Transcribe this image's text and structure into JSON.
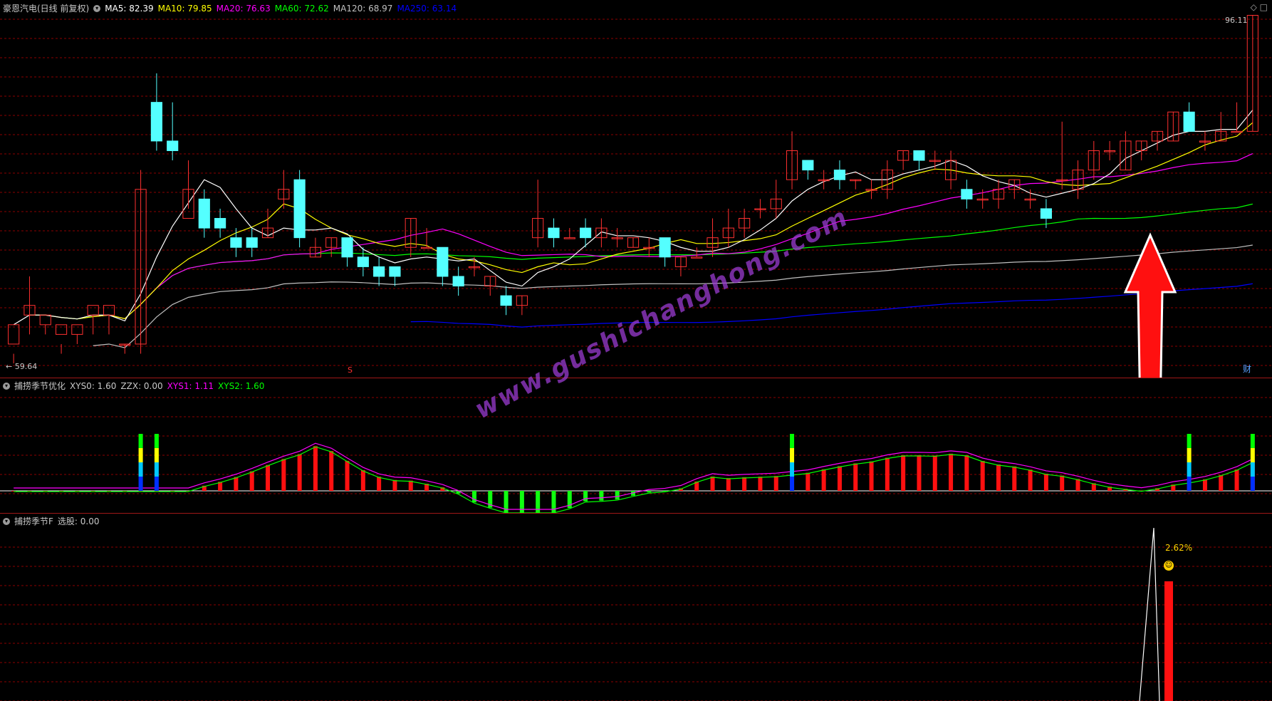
{
  "main_panel": {
    "title": "豪恩汽电(日线 前复权)",
    "ma_labels": [
      {
        "text": "MA5: 82.39",
        "color": "#ffffff"
      },
      {
        "text": "MA10: 79.85",
        "color": "#ffff00"
      },
      {
        "text": "MA20: 76.63",
        "color": "#ff00ff"
      },
      {
        "text": "MA60: 72.62",
        "color": "#00ff00"
      },
      {
        "text": "MA120: 68.97",
        "color": "#c0c0c0"
      },
      {
        "text": "MA250: 63.14",
        "color": "#0000ff"
      }
    ],
    "max_label": "96.11",
    "min_label": "59.64",
    "s_marker": "S",
    "cai_marker": "财",
    "icons": [
      "diamond-icon",
      "window-icon"
    ]
  },
  "panel2": {
    "title": "捕捞季节优化",
    "labels": [
      {
        "text": "XYS0: 1.60",
        "color": "#c8c8c8"
      },
      {
        "text": "ZZX: 0.00",
        "color": "#c8c8c8"
      },
      {
        "text": "XYS1: 1.11",
        "color": "#ff00ff"
      },
      {
        "text": "XYS2: 1.60",
        "color": "#00ff00"
      }
    ]
  },
  "panel3": {
    "title": "捕捞季节F",
    "labels": [
      {
        "text": "选股: 0.00",
        "color": "#c8c8c8"
      }
    ],
    "percent_label": "2.62%",
    "smile_icon": "smile-icon"
  },
  "watermark": "www.gushichanghong.com",
  "colors": {
    "up": "#ff3030",
    "down": "#54ffff",
    "grid": "#8b0000",
    "ma5": "#ffffff",
    "ma10": "#ffff00",
    "ma20": "#ff00ff",
    "ma60": "#00ff00",
    "ma120": "#c0c0c0",
    "ma250": "#0000ff"
  },
  "chart_data": {
    "type": "candlestick",
    "y_range": [
      59.64,
      96.11
    ],
    "candles": [
      [
        62,
        64,
        61,
        60
      ],
      [
        65,
        66,
        63,
        69
      ],
      [
        64,
        65,
        63,
        64
      ],
      [
        63,
        64,
        62,
        61
      ],
      [
        63,
        64,
        62,
        63
      ],
      [
        65,
        66,
        63,
        65
      ],
      [
        65,
        66,
        63,
        65
      ],
      [
        62,
        62,
        61,
        62
      ],
      [
        62,
        78,
        61,
        80
      ],
      [
        87,
        83,
        82,
        90
      ],
      [
        83,
        82,
        81,
        87
      ],
      [
        75,
        78,
        76,
        81
      ],
      [
        77,
        74,
        73,
        78
      ],
      [
        75,
        74,
        73,
        76
      ],
      [
        73,
        72,
        71,
        74
      ],
      [
        73,
        72,
        71,
        74
      ],
      [
        73,
        74,
        73,
        76
      ],
      [
        77,
        78,
        76,
        80
      ],
      [
        79,
        73,
        72,
        80
      ],
      [
        71,
        72,
        71,
        73
      ],
      [
        72,
        73,
        71,
        73
      ],
      [
        73,
        71,
        70,
        73
      ],
      [
        71,
        70,
        69,
        72
      ],
      [
        70,
        69,
        68,
        71
      ],
      [
        70,
        69,
        68,
        70
      ],
      [
        72,
        75,
        71,
        75
      ],
      [
        72,
        72,
        72,
        74
      ],
      [
        72,
        69,
        68,
        72
      ],
      [
        69,
        68,
        67,
        70
      ],
      [
        70,
        70,
        69,
        71
      ],
      [
        68,
        69,
        67,
        69
      ],
      [
        67,
        66,
        65,
        68
      ],
      [
        66,
        67,
        65,
        67
      ],
      [
        73,
        75,
        72,
        79
      ],
      [
        74,
        73,
        72,
        75
      ],
      [
        73,
        73,
        73,
        74
      ],
      [
        74,
        73,
        72,
        75
      ],
      [
        73,
        74,
        72,
        75
      ],
      [
        73,
        73,
        72,
        74
      ],
      [
        72,
        73,
        72,
        73
      ],
      [
        72,
        72,
        71,
        73
      ],
      [
        73,
        71,
        70,
        73
      ],
      [
        70,
        71,
        69,
        71
      ],
      [
        71,
        71,
        71,
        72
      ],
      [
        72,
        73,
        71,
        75
      ],
      [
        73,
        74,
        72,
        76
      ],
      [
        74,
        75,
        73,
        76
      ],
      [
        76,
        76,
        75,
        77
      ],
      [
        76,
        77,
        75,
        79
      ],
      [
        79,
        82,
        78,
        84
      ],
      [
        81,
        80,
        79,
        81
      ],
      [
        79,
        79,
        78,
        80
      ],
      [
        80,
        79,
        78,
        81
      ],
      [
        79,
        79,
        78,
        79
      ],
      [
        78,
        78,
        77,
        79
      ],
      [
        78,
        80,
        77,
        81
      ],
      [
        81,
        82,
        80,
        82
      ],
      [
        82,
        81,
        80,
        82
      ],
      [
        81,
        81,
        80,
        82
      ],
      [
        79,
        81,
        78,
        82
      ],
      [
        78,
        77,
        76,
        79
      ],
      [
        77,
        77,
        76,
        78
      ],
      [
        77,
        78,
        76,
        79
      ],
      [
        78,
        79,
        77,
        79
      ],
      [
        77,
        77,
        76,
        78
      ],
      [
        76,
        75,
        74,
        77
      ],
      [
        79,
        79,
        78,
        85
      ],
      [
        78,
        80,
        77,
        81
      ],
      [
        80,
        82,
        79,
        83
      ],
      [
        82,
        82,
        81,
        83
      ],
      [
        80,
        83,
        80,
        84
      ],
      [
        82,
        83,
        81,
        83
      ],
      [
        83,
        84,
        82,
        84
      ],
      [
        83,
        86,
        83,
        86
      ],
      [
        86,
        84,
        84,
        87
      ],
      [
        83,
        83,
        82,
        84
      ],
      [
        83,
        84,
        83,
        86
      ],
      [
        84,
        84,
        84,
        87
      ],
      [
        84,
        96,
        84,
        96
      ]
    ],
    "x_count": 79
  }
}
